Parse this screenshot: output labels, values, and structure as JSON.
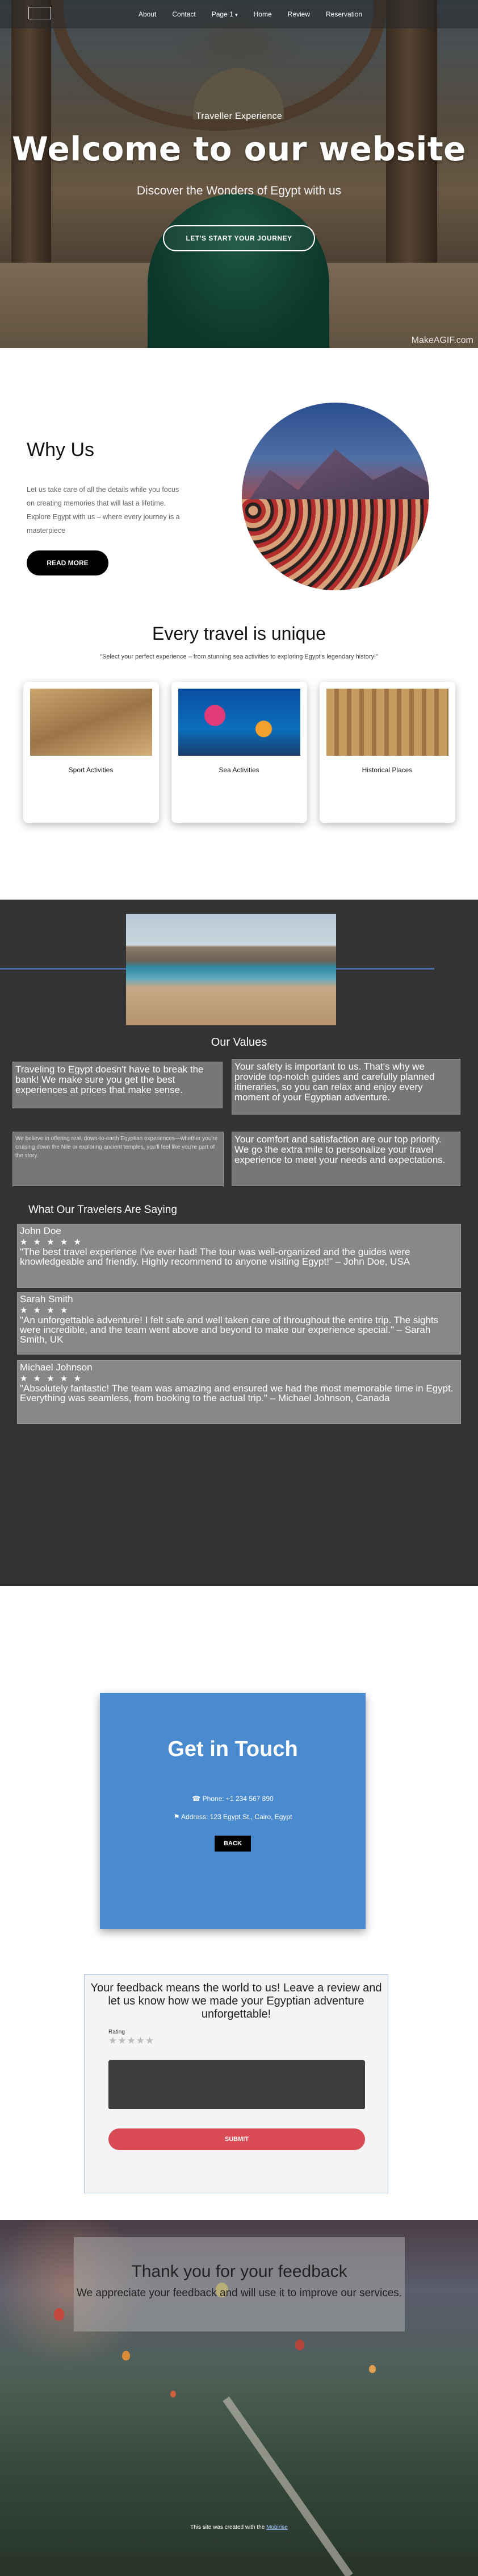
{
  "nav": {
    "items": [
      "About",
      "Contact",
      "Page 1",
      "Home",
      "Review",
      "Reservation"
    ],
    "page1_caret": "▾"
  },
  "hero": {
    "subtitle": "Traveller Experience",
    "title": "Welcome to our website",
    "tagline": "Discover the Wonders of Egypt with us",
    "cta": "LET'S START YOUR JOURNEY",
    "watermark": "MakeAGIF.com"
  },
  "why": {
    "title": "Why Us",
    "text": "Let us take care of all the details while you focus on creating memories that will last a lifetime. Explore Egypt with us – where every journey is a masterpiece",
    "button": "READ MORE"
  },
  "travel": {
    "title": "Every travel is unique",
    "quote": "\"Select your perfect experience – from stunning sea activities to exploring Egypt's legendary history!\"",
    "cards": [
      {
        "label": "Sport Activities"
      },
      {
        "label": "Sea Activities"
      },
      {
        "label": "Historical Places"
      }
    ]
  },
  "values": {
    "title": "Our Values",
    "v1": "Traveling to Egypt doesn't have to break the bank! We make sure you get the best experiences at prices that make sense.",
    "v2": "Your safety is important to us. That's why we provide top-notch guides and carefully planned itineraries, so you can relax and enjoy every moment of your Egyptian adventure.",
    "v3": "We believe in offering real, down-to-earth Egyptian experiences—whether you're cruising down the Nile or exploring ancient temples, you'll feel like you're part of the story.",
    "v4": "Your comfort and satisfaction are our top priority. We go the extra mile to personalize your travel experience to meet your needs and expectations."
  },
  "testimonials": {
    "title": "What Our Travelers Are Saying",
    "items": [
      {
        "name": "John Doe",
        "stars": "★ ★ ★ ★ ★",
        "text": "\"The best travel experience I've ever had! The tour was well-organized and the guides were knowledgeable and friendly. Highly recommend to anyone visiting Egypt!\" – John Doe, USA"
      },
      {
        "name": "Sarah Smith",
        "stars": "★ ★ ★ ★",
        "text": "\"An unforgettable adventure! I felt safe and well taken care of throughout the entire trip. The sights were incredible, and the team went above and beyond to make our experience special.\" – Sarah Smith, UK"
      },
      {
        "name": "Michael Johnson",
        "stars": "★ ★ ★ ★ ★",
        "text": "\"Absolutely fantastic! The team was amazing and ensured we had the most memorable time in Egypt. Everything was seamless, from booking to the actual trip.\" – Michael Johnson, Canada"
      }
    ]
  },
  "contact": {
    "title": "Get in Touch",
    "phone": "Phone: +1 234 567 890",
    "address": "Address: 123 Egypt St., Cairo, Egypt",
    "back": "BACK",
    "brand_color": "#4a8bd0"
  },
  "feedback": {
    "heading": "Your feedback means the world to us! Leave a review and let us know how we made your Egyptian adventure unforgettable!",
    "rating_label": "Rating",
    "rating_stars": "★★★★★",
    "submit": "SUBMIT",
    "submit_color": "#d94b55"
  },
  "thanks": {
    "title": "Thank you for your feedback",
    "text": "We appreciate your feedback and will use it to improve our services."
  },
  "footer": {
    "text": "This site was created with the ",
    "link": "Mobirise"
  },
  "icons": {
    "phone": "phone-icon",
    "location": "location-pin-icon"
  }
}
